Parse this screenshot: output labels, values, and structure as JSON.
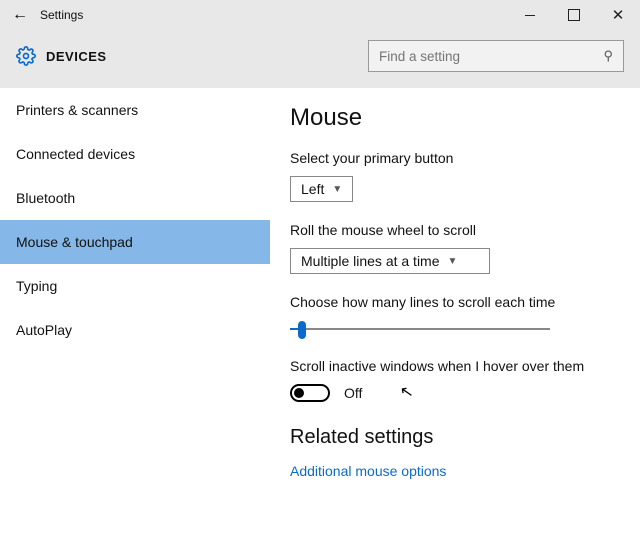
{
  "window": {
    "title": "Settings"
  },
  "header": {
    "section": "DEVICES",
    "search_placeholder": "Find a setting"
  },
  "sidebar": {
    "items": [
      {
        "label": "Printers & scanners"
      },
      {
        "label": "Connected devices"
      },
      {
        "label": "Bluetooth"
      },
      {
        "label": "Mouse & touchpad"
      },
      {
        "label": "Typing"
      },
      {
        "label": "AutoPlay"
      }
    ],
    "active_index": 3
  },
  "main": {
    "title": "Mouse",
    "primary_button": {
      "label": "Select your primary button",
      "value": "Left"
    },
    "wheel_mode": {
      "label": "Roll the mouse wheel to scroll",
      "value": "Multiple lines at a time"
    },
    "scroll_lines": {
      "label": "Choose how many lines to scroll each time"
    },
    "inactive_scroll": {
      "label": "Scroll inactive windows when I hover over them",
      "state": "Off"
    },
    "related": {
      "heading": "Related settings",
      "link": "Additional mouse options"
    }
  }
}
